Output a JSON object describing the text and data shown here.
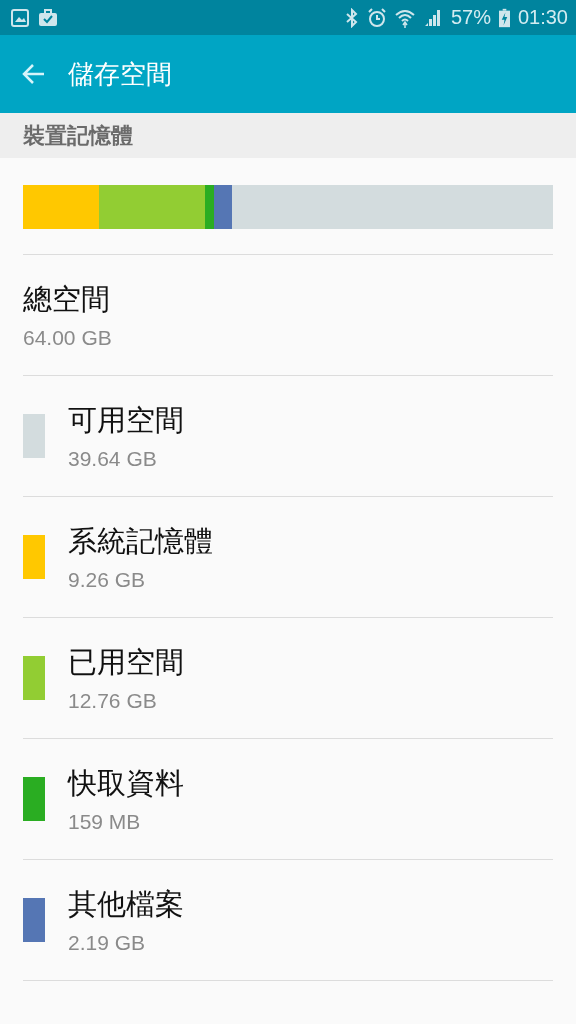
{
  "status_bar": {
    "battery": "57%",
    "time": "01:30"
  },
  "app_bar": {
    "title": "儲存空間"
  },
  "section": {
    "title": "裝置記憶體"
  },
  "total": {
    "label": "總空間",
    "value": "64.00 GB"
  },
  "categories": [
    {
      "kind": "free",
      "label": "可用空間",
      "value": "39.64 GB",
      "color": "#d3dcde"
    },
    {
      "kind": "used",
      "label": "系統記憶體",
      "value": "9.26 GB",
      "color": "#ffc800"
    },
    {
      "kind": "used",
      "label": "已用空間",
      "value": "12.76 GB",
      "color": "#92cd33"
    },
    {
      "kind": "used",
      "label": "快取資料",
      "value": "159 MB",
      "color": "#2aad22"
    },
    {
      "kind": "used",
      "label": "其他檔案",
      "value": "2.19 GB",
      "color": "#5576b4"
    }
  ]
}
